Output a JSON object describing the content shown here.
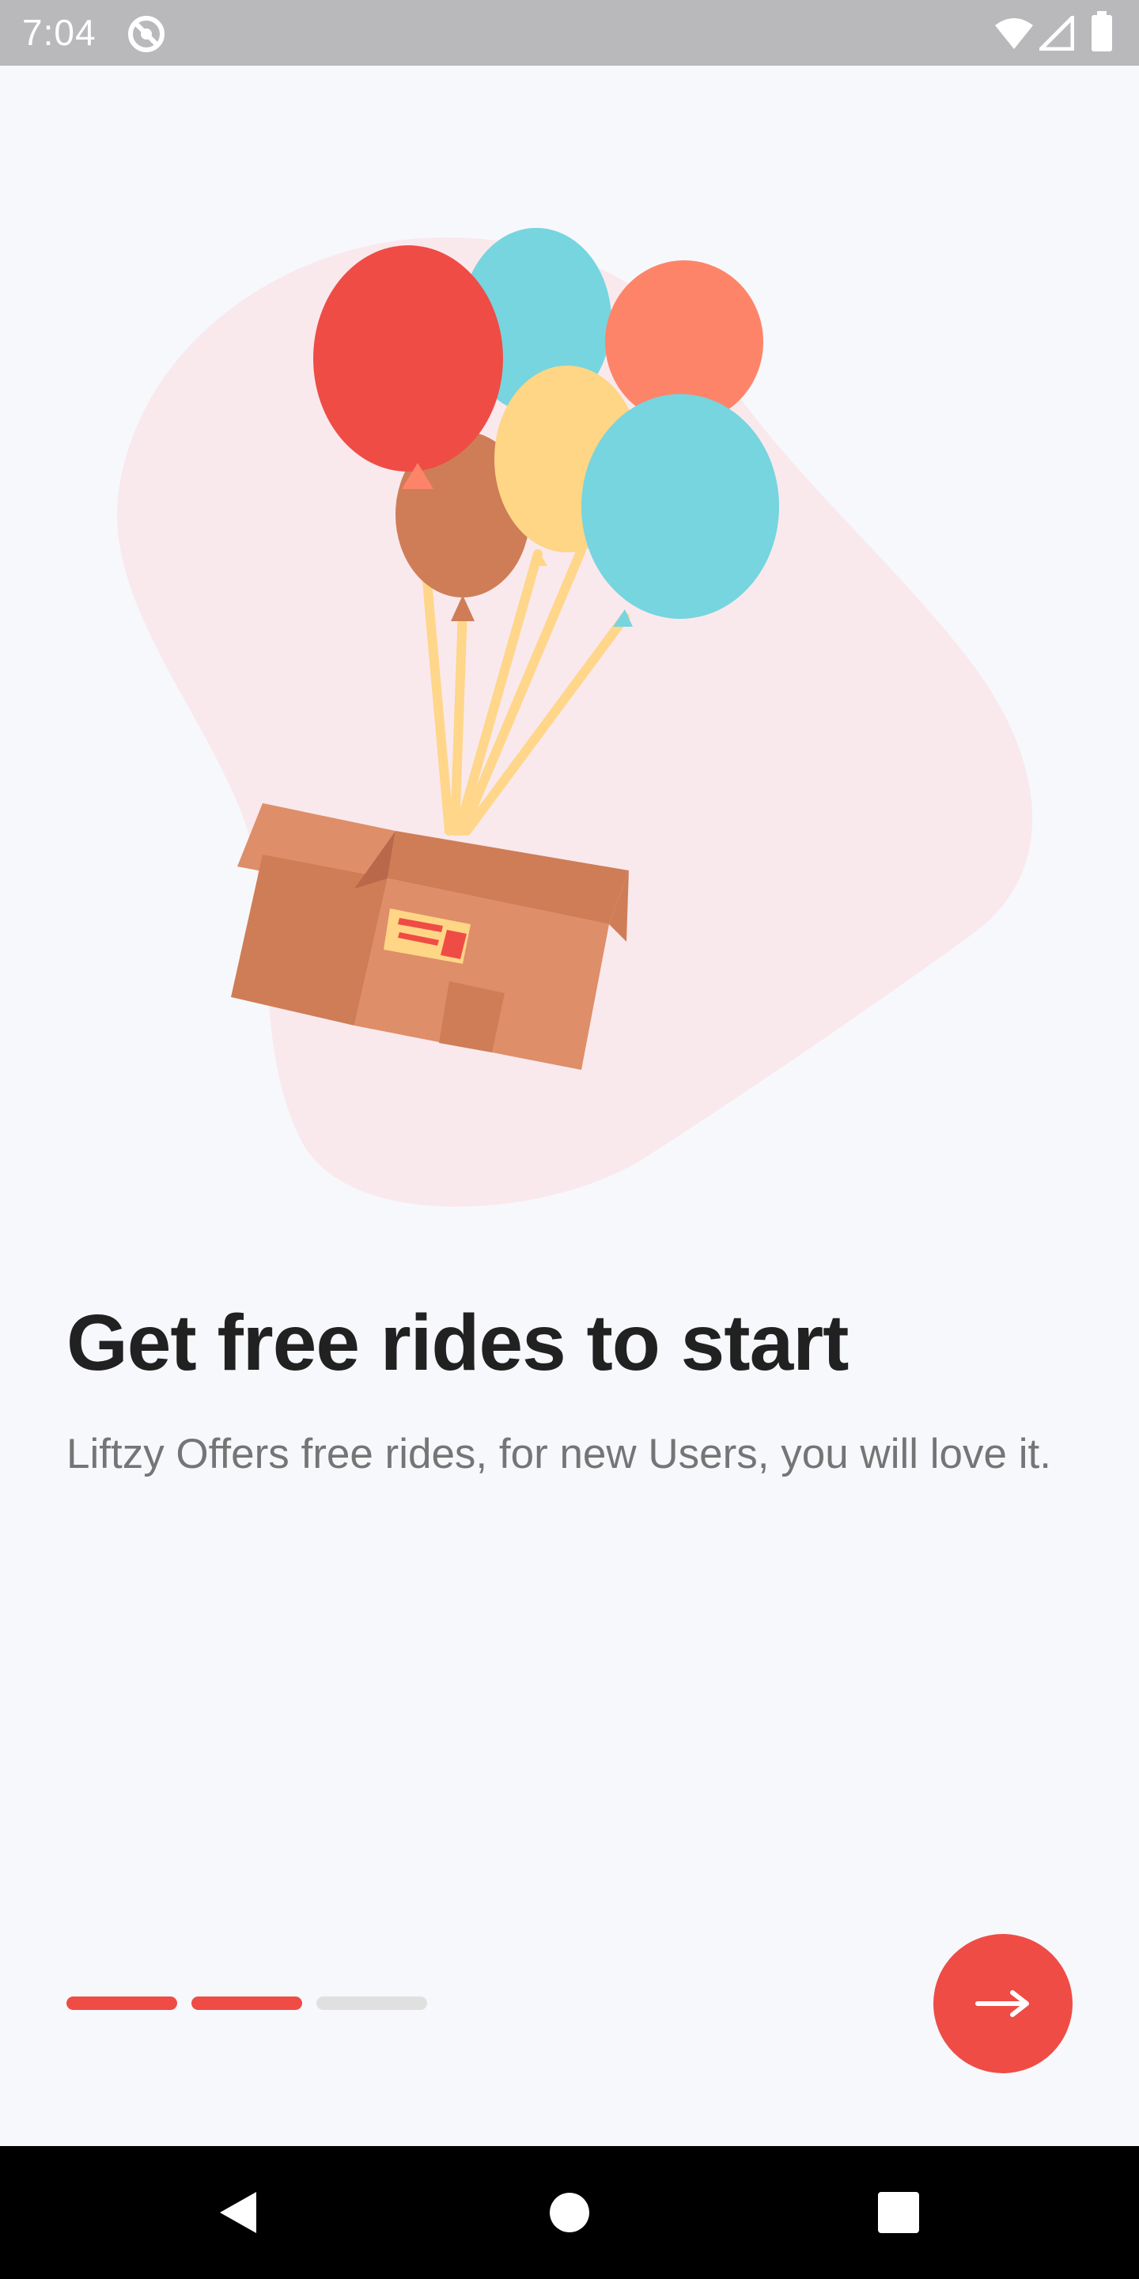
{
  "status_bar": {
    "time": "7:04",
    "icons": [
      "sync-icon",
      "wifi-icon",
      "cellular-signal-icon",
      "battery-icon"
    ]
  },
  "onboarding": {
    "title": "Get free rides to start",
    "subtitle": "Liftzy Offers free rides, for new Users, you will love it.",
    "illustration": "balloons-lifting-box",
    "page_indicator": {
      "total": 3,
      "active_pages": [
        1,
        2
      ],
      "active_color": "#ef4c45",
      "inactive_color": "#e0e0e0"
    },
    "next_button": {
      "icon": "arrow-right-icon",
      "color": "#ef4c45"
    }
  },
  "nav_bar": {
    "buttons": [
      "back-triangle-icon",
      "home-circle-icon",
      "recents-square-icon"
    ]
  },
  "colors": {
    "background": "#f7f8fc",
    "accent": "#ef4c45",
    "title_text": "#212121",
    "subtitle_text": "#757575"
  }
}
